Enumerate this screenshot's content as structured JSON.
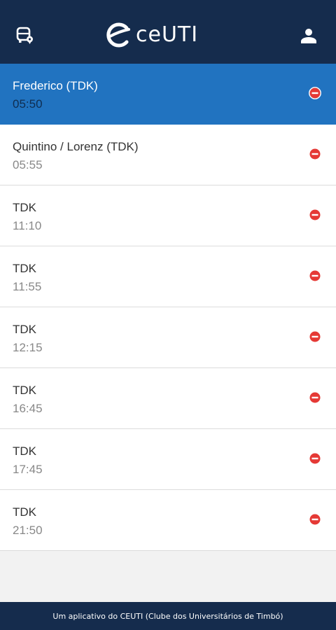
{
  "header": {
    "brand": "ceUTI",
    "left_icon": "bus-marker-icon",
    "right_icon": "user-icon"
  },
  "colors": {
    "header_bg": "#152c4d",
    "selected_row": "#2173c0",
    "remove_icon": "#e53935"
  },
  "trips": [
    {
      "route": "Frederico (TDK)",
      "time": "05:50",
      "selected": true
    },
    {
      "route": "Quintino / Lorenz (TDK)",
      "time": "05:55",
      "selected": false
    },
    {
      "route": "TDK",
      "time": "11:10",
      "selected": false
    },
    {
      "route": "TDK",
      "time": "11:55",
      "selected": false
    },
    {
      "route": "TDK",
      "time": "12:15",
      "selected": false
    },
    {
      "route": "TDK",
      "time": "16:45",
      "selected": false
    },
    {
      "route": "TDK",
      "time": "17:45",
      "selected": false
    },
    {
      "route": "TDK",
      "time": "21:50",
      "selected": false
    }
  ],
  "footer": {
    "text": "Um aplicativo do CEUTI (Clube dos Universitários de Timbó)"
  }
}
